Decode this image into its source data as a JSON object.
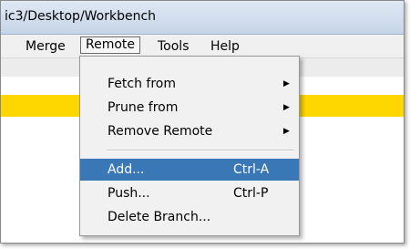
{
  "window": {
    "title": "ic3/Desktop/Workbench"
  },
  "menubar": {
    "items": [
      {
        "label": "Merge"
      },
      {
        "label": "Remote"
      },
      {
        "label": "Tools"
      },
      {
        "label": "Help"
      }
    ],
    "active": "Remote"
  },
  "dropdown": {
    "items": [
      {
        "label": "Fetch from",
        "submenu": true
      },
      {
        "label": "Prune from",
        "submenu": true
      },
      {
        "label": "Remove Remote",
        "submenu": true
      },
      {
        "label": "Add...",
        "shortcut": "Ctrl-A",
        "selected": true
      },
      {
        "label": "Push...",
        "shortcut": "Ctrl-P"
      },
      {
        "label": "Delete Branch..."
      }
    ],
    "submenu_icon": "triangle-right-icon"
  },
  "colors": {
    "selection": "#3a77b6",
    "highlight_strip": "#ffd700",
    "menu_background": "#f1f1f1"
  }
}
